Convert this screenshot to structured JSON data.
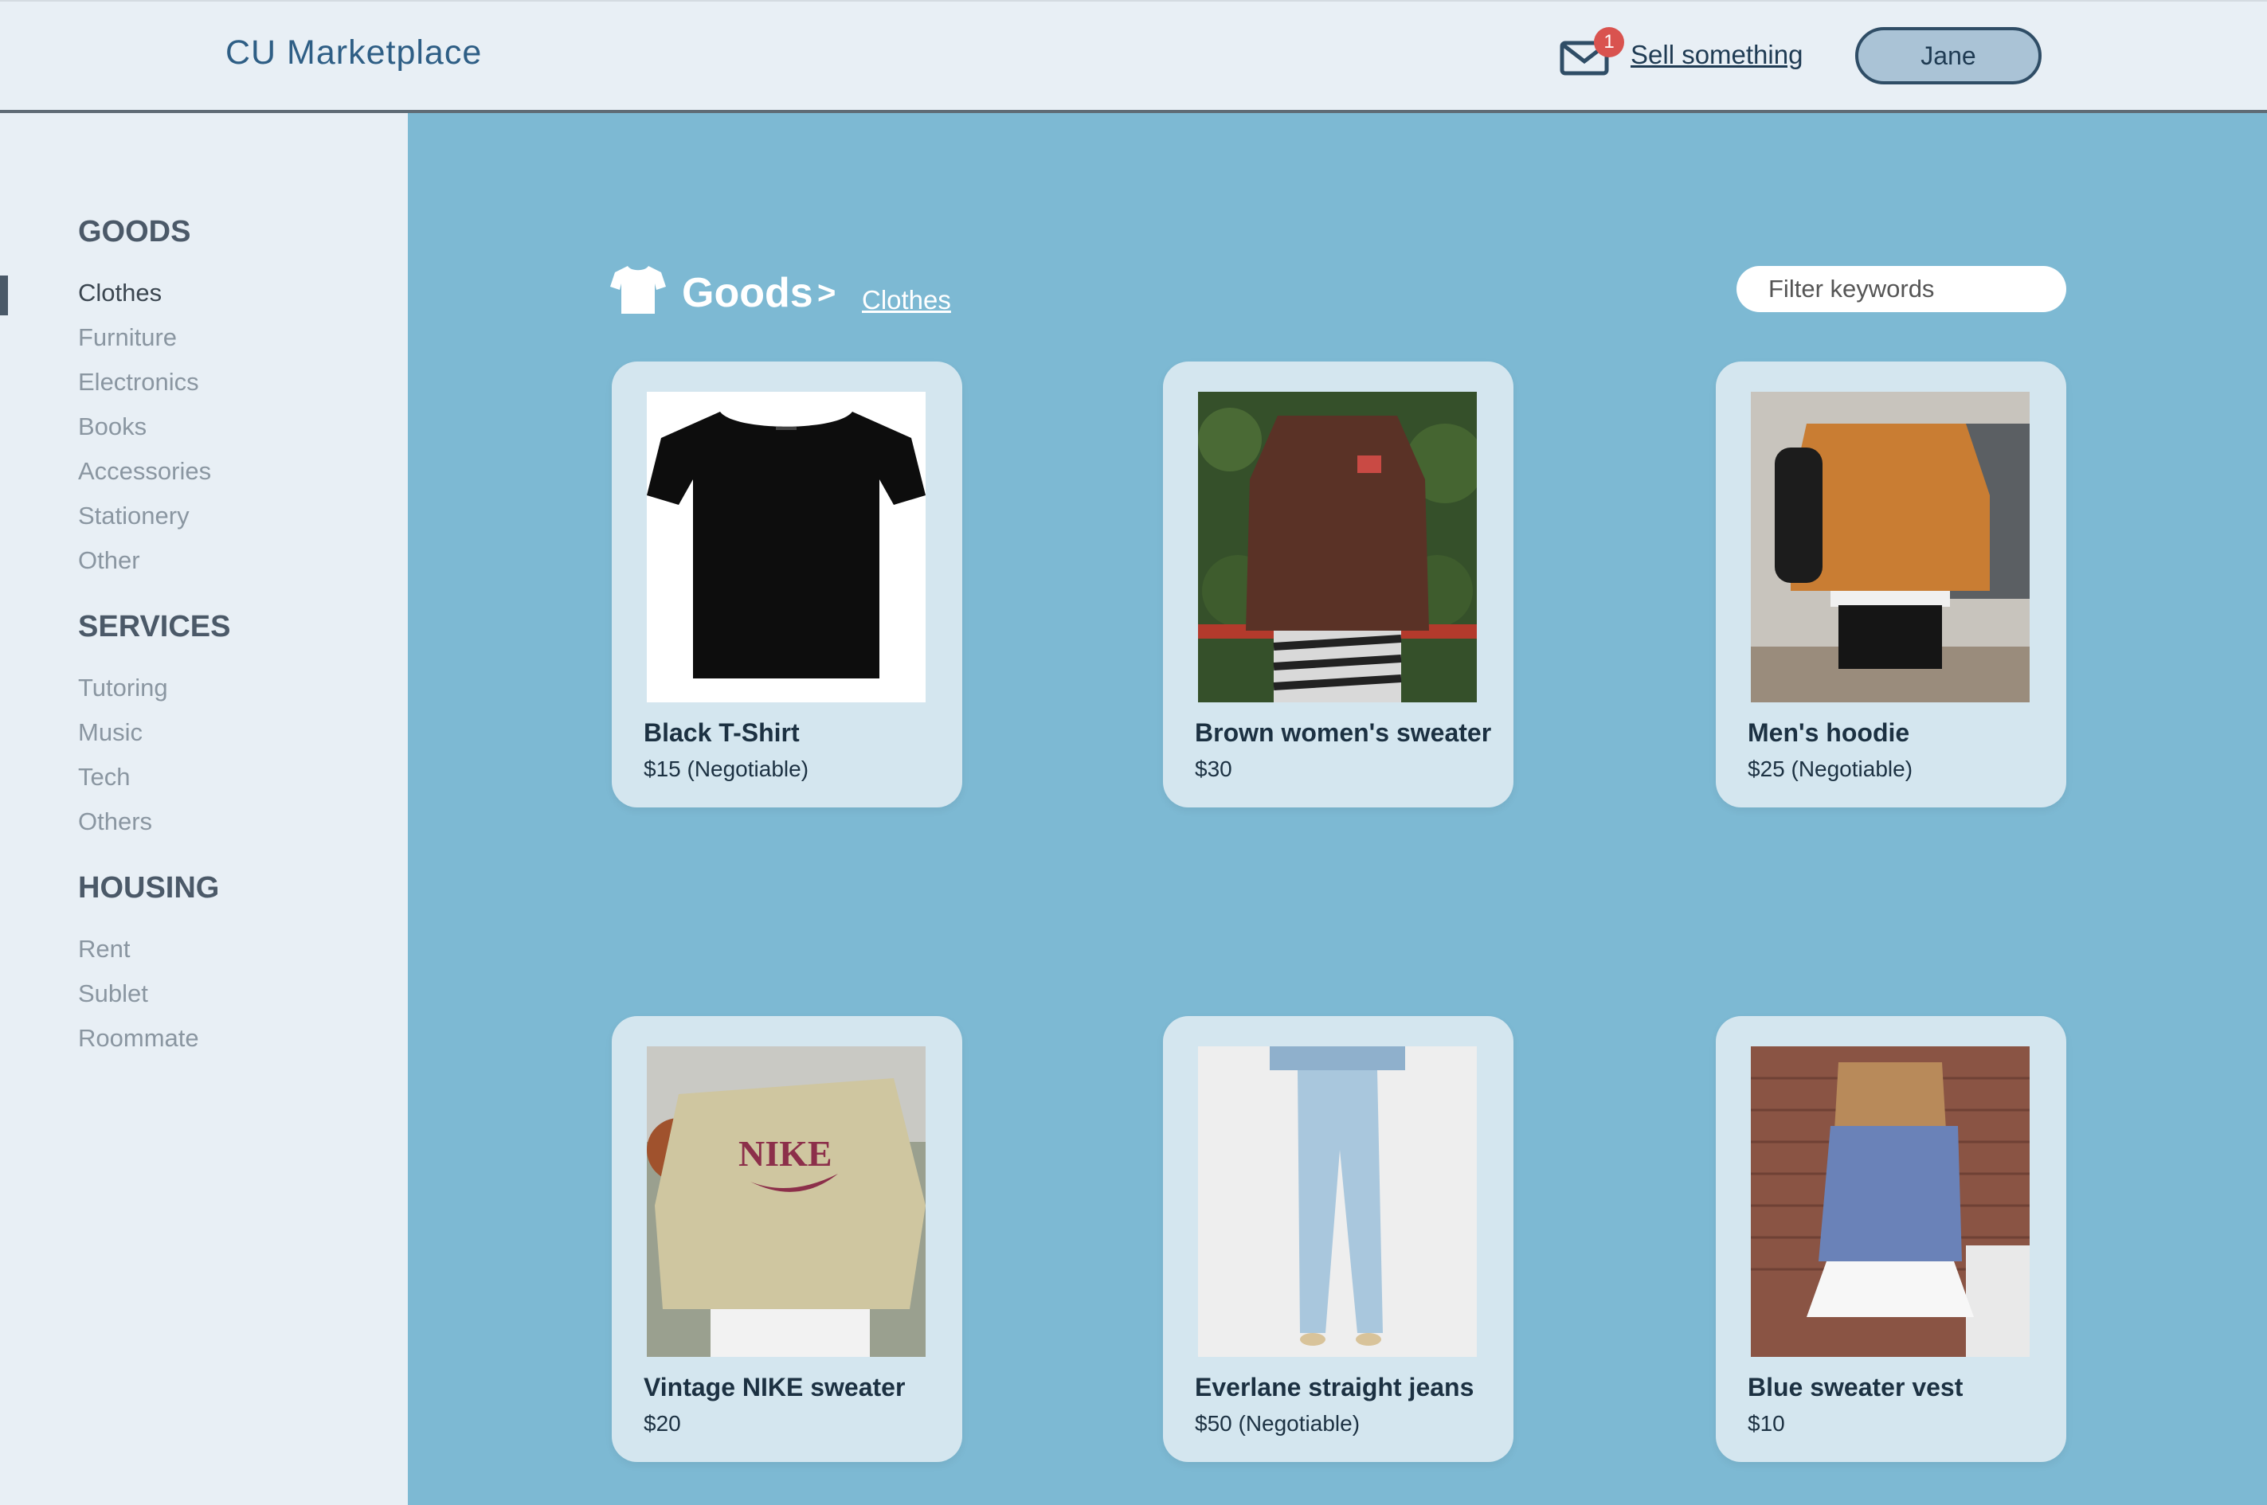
{
  "header": {
    "brand": "CU Marketplace",
    "notification_count": "1",
    "sell_label": "Sell something",
    "user_label": "Jane",
    "mail_icon": "mail-icon"
  },
  "sidebar": {
    "goods_title": "GOODS",
    "goods_items": [
      "Clothes",
      "Furniture",
      "Electronics",
      "Books",
      "Accessories",
      "Stationery",
      "Other"
    ],
    "services_title": "SERVICES",
    "services_items": [
      "Tutoring",
      "Music",
      "Tech",
      "Others"
    ],
    "housing_title": "HOUSING",
    "housing_items": [
      "Rent",
      "Sublet",
      "Roommate"
    ],
    "active_item": "Clothes"
  },
  "main": {
    "category_icon": "shirt-icon",
    "breadcrumb_root": "Goods",
    "breadcrumb_sep": ">",
    "breadcrumb_current": "Clothes",
    "filter_placeholder": "Filter keywords",
    "listings": [
      {
        "title": "Black T-Shirt",
        "price": "$15 (Negotiable)"
      },
      {
        "title": "Brown women's sweater",
        "price": "$30"
      },
      {
        "title": "Men's hoodie",
        "price": "$25 (Negotiable)"
      },
      {
        "title": "Vintage NIKE sweater",
        "price": "$20"
      },
      {
        "title": "Everlane straight jeans",
        "price": "$50 (Negotiable)"
      },
      {
        "title": "Blue sweater vest",
        "price": "$10"
      }
    ]
  },
  "colors": {
    "main_bg": "#7db9d3",
    "sidebar_bg": "#e8eff5",
    "card_bg": "#d4e6ef",
    "badge": "#d9534f",
    "brand": "#2e5e85"
  }
}
